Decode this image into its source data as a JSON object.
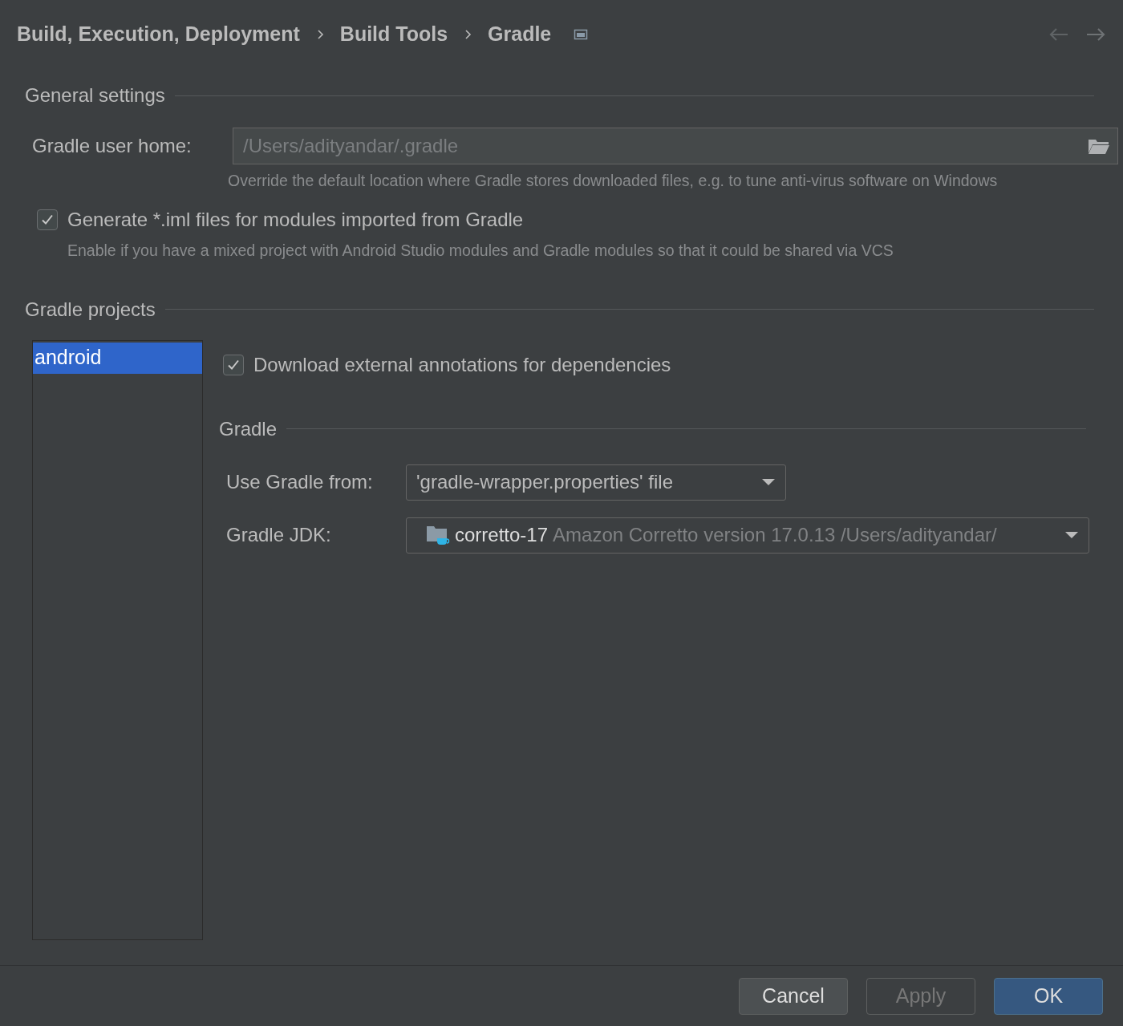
{
  "breadcrumb": [
    "Build, Execution, Deployment",
    "Build Tools",
    "Gradle"
  ],
  "general_settings": {
    "title": "General settings",
    "user_home": {
      "label": "Gradle user home:",
      "placeholder": "/Users/adityandar/.gradle",
      "hint": "Override the default location where Gradle stores downloaded files, e.g. to tune anti-virus software on Windows"
    },
    "generate_iml": {
      "label": "Generate *.iml files for modules imported from Gradle",
      "checked": true,
      "hint": "Enable if you have a mixed project with Android Studio modules and Gradle modules so that it could be shared via VCS"
    }
  },
  "gradle_projects": {
    "title": "Gradle projects",
    "projects": [
      {
        "name": "android",
        "selected": true
      }
    ],
    "download_annotations": {
      "label": "Download external annotations for dependencies",
      "checked": true
    },
    "gradle": {
      "title": "Gradle",
      "use_gradle_from": {
        "label": "Use Gradle from:",
        "value": "'gradle-wrapper.properties' file"
      },
      "gradle_jdk": {
        "label": "Gradle JDK:",
        "name": "corretto-17",
        "detail": "Amazon Corretto version 17.0.13 /Users/adityandar/"
      }
    }
  },
  "buttons": [
    {
      "label": "Cancel",
      "kind": "default"
    },
    {
      "label": "Apply",
      "kind": "disabled"
    },
    {
      "label": "OK",
      "kind": "primary"
    }
  ]
}
